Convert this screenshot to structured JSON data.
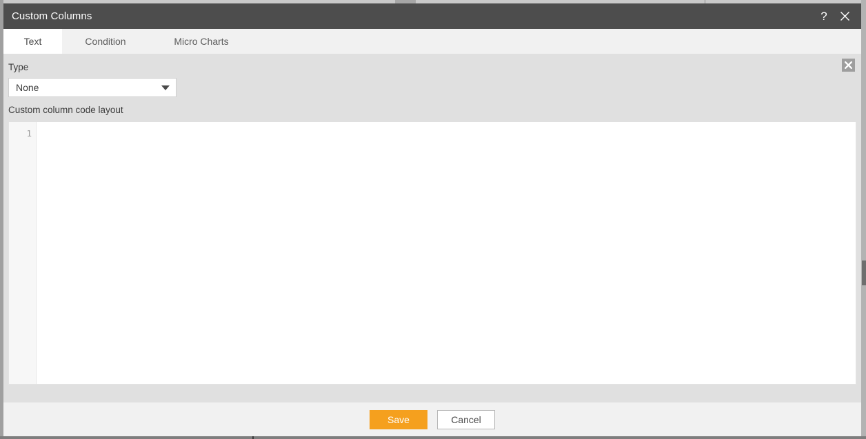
{
  "window": {
    "title": "Custom Columns",
    "help_icon": "question-mark-icon",
    "close_icon": "close-icon"
  },
  "tabs": [
    {
      "label": "Text",
      "active": true
    },
    {
      "label": "Condition",
      "active": false
    },
    {
      "label": "Micro Charts",
      "active": false
    }
  ],
  "form": {
    "type_label": "Type",
    "type_value": "None",
    "type_dropdown_icon": "chevron-down-icon",
    "remove_icon": "remove-x-icon",
    "code_label": "Custom column code layout"
  },
  "editor": {
    "line_numbers": [
      "1"
    ],
    "content": "",
    "placeholder": ""
  },
  "footer": {
    "save_label": "Save",
    "cancel_label": "Cancel"
  },
  "colors": {
    "titlebar": "#4d4d4d",
    "accent": "#f5a01e",
    "panel": "#e0e0e0",
    "footer": "#f1f1f1",
    "tab_active": "#ffffff",
    "editor_bg": "#ffffff",
    "gutter_bg": "#f7f7f7",
    "page_bg": "#9a9a9a"
  }
}
